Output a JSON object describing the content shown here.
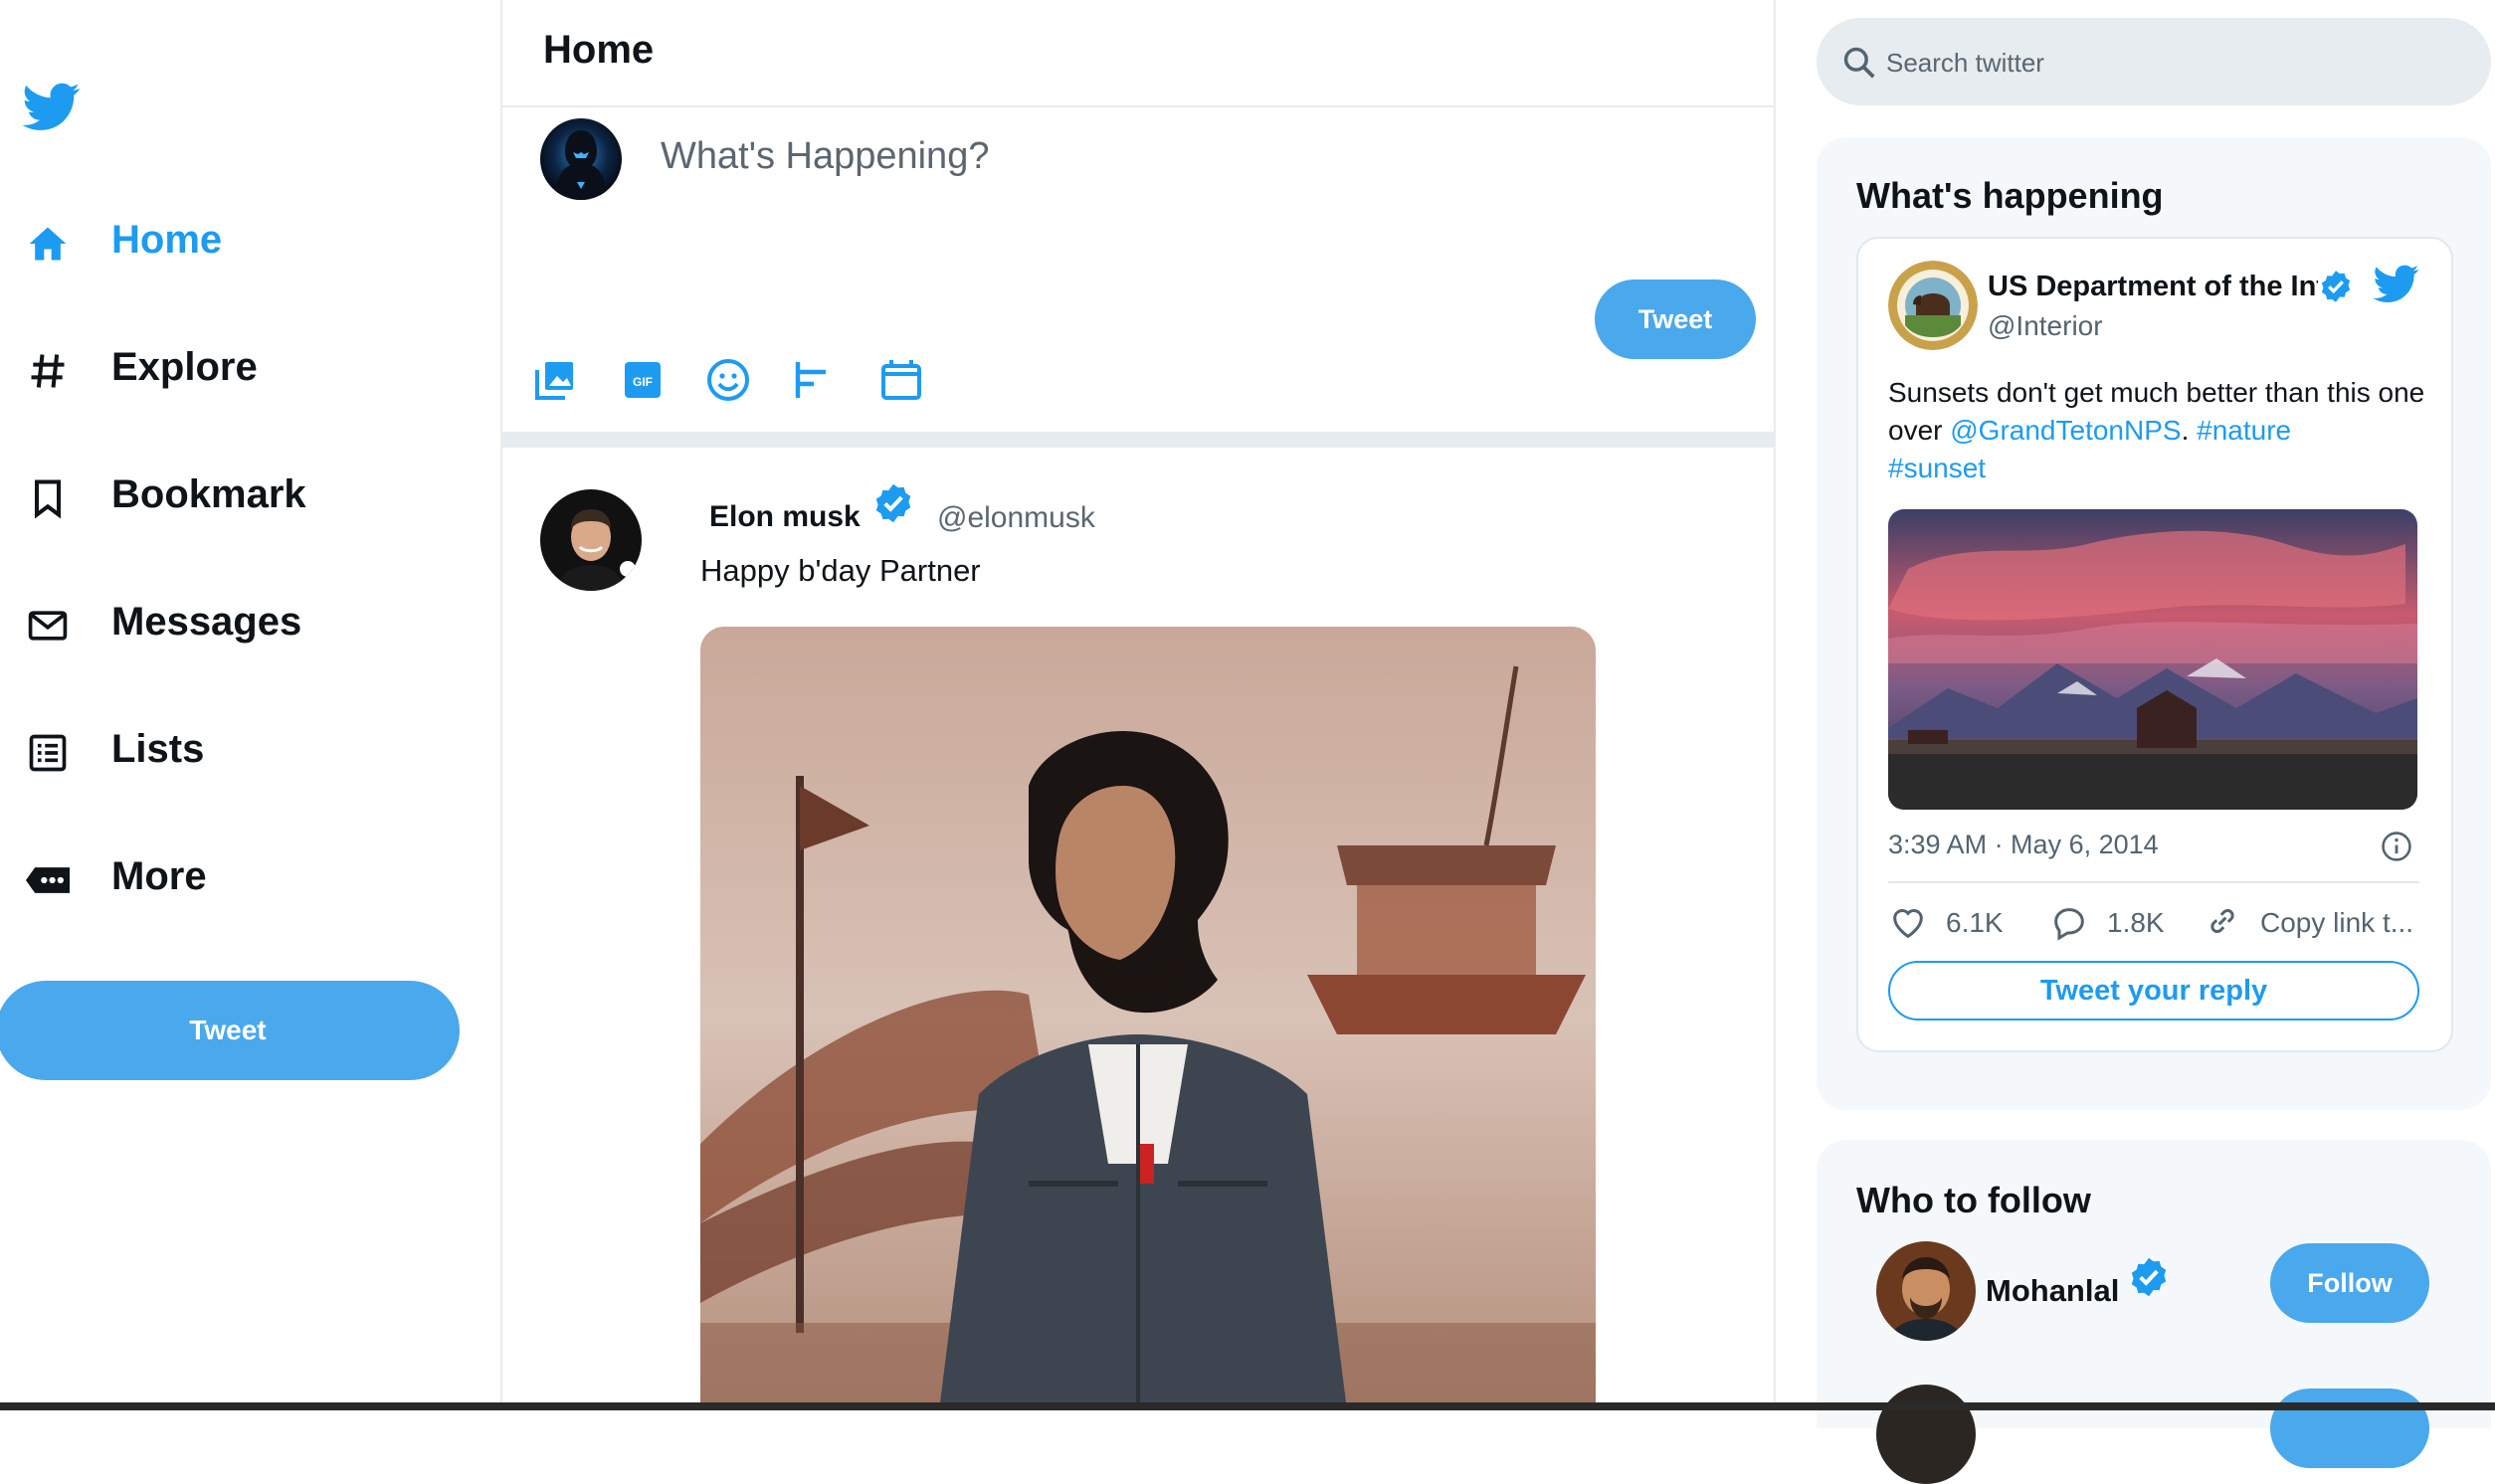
{
  "colors": {
    "accent": "#1d9bf0",
    "button": "#4aa8ec",
    "panel": "#f5f8fa",
    "text_secondary": "#5b6670"
  },
  "nav": {
    "logo_icon": "twitter-bird-icon",
    "items": [
      {
        "label": "Home",
        "icon": "home-icon",
        "active": true
      },
      {
        "label": "Explore",
        "icon": "hashtag-icon"
      },
      {
        "label": "Bookmark",
        "icon": "bookmark-icon"
      },
      {
        "label": "Messages",
        "icon": "envelope-icon"
      },
      {
        "label": "Lists",
        "icon": "list-icon"
      },
      {
        "label": "More",
        "icon": "more-icon"
      }
    ],
    "tweet_label": "Tweet"
  },
  "main": {
    "title": "Home",
    "compose": {
      "placeholder": "What's Happening?",
      "tweet_label": "Tweet",
      "toolbar_icons": [
        "image-icon",
        "gif-icon",
        "emoji-icon",
        "poll-icon",
        "schedule-icon"
      ],
      "gif_text": "GIF"
    },
    "post": {
      "name": "Elon musk",
      "handle": "@elonmusk",
      "text": "Happy b'day Partner"
    }
  },
  "search": {
    "placeholder": "Search twitter"
  },
  "trends": {
    "title": "What's happening",
    "embed": {
      "name": "US Department of the Interior",
      "handle": "@Interior",
      "text_before": "Sunsets don't get much better than this one over ",
      "mention": "@GrandTetonNPS",
      "dot": ". ",
      "tag1": "#nature",
      "tag2": "#sunset",
      "time": "3:39 AM · May 6, 2014",
      "likes": "6.1K",
      "replies": "1.8K",
      "copy_link": "Copy link t...",
      "reply_button": "Tweet your reply"
    }
  },
  "who_to_follow": {
    "title": "Who to follow",
    "accounts": [
      {
        "name": "Mohanlal",
        "button": "Follow"
      }
    ]
  }
}
